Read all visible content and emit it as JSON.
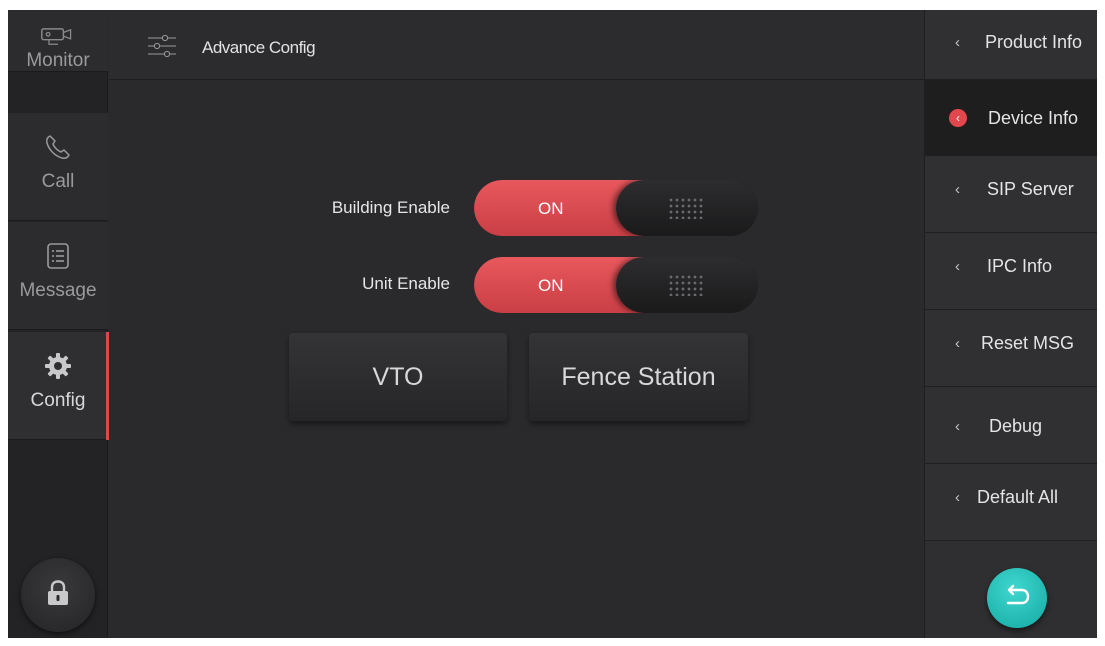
{
  "left_nav": {
    "items": [
      {
        "label": "Monitor",
        "icon": "camera-icon",
        "active": false
      },
      {
        "label": "Call",
        "icon": "phone-icon",
        "active": false
      },
      {
        "label": "Message",
        "icon": "message-list-icon",
        "active": false
      },
      {
        "label": "Config",
        "icon": "gear-icon",
        "active": true
      }
    ],
    "lock_icon": "lock-icon"
  },
  "header": {
    "icon": "sliders-icon",
    "title": "Advance Config"
  },
  "main": {
    "building_enable": {
      "label": "Building Enable",
      "state": "ON"
    },
    "unit_enable": {
      "label": "Unit Enable",
      "state": "ON"
    },
    "buttons": {
      "vto": "VTO",
      "fence_station": "Fence Station"
    }
  },
  "right_nav": {
    "items": [
      {
        "label": "Product Info",
        "active": false
      },
      {
        "label": "Device Info",
        "active": true
      },
      {
        "label": "SIP Server",
        "active": false
      },
      {
        "label": "IPC Info",
        "active": false
      },
      {
        "label": "Reset MSG",
        "active": false
      },
      {
        "label": "Debug",
        "active": false
      },
      {
        "label": "Default All",
        "active": false
      }
    ],
    "chevron": "‹",
    "back_icon": "back-arrow-icon"
  },
  "colors": {
    "accent_red": "#e2474d",
    "toggle_on": "#d94a4f",
    "back_teal": "#1fbfb7",
    "background": "#2a2a2c"
  }
}
